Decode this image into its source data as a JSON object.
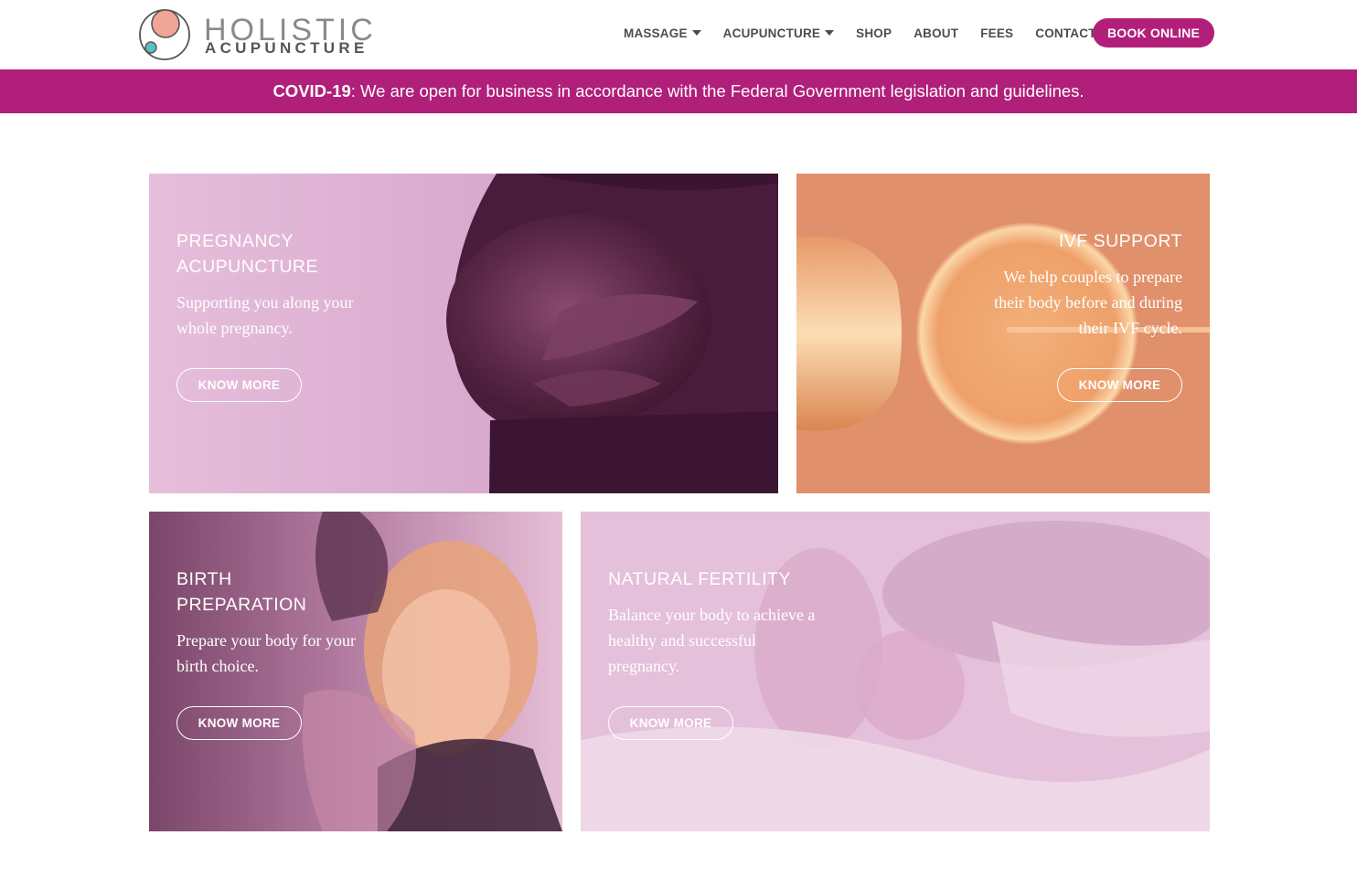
{
  "brand": {
    "line1": "HOLISTIC",
    "line2": "ACUPUNCTURE",
    "colors": {
      "accent": "#b01f79",
      "circle_large": "#f0a597",
      "circle_small": "#5bbfc3"
    }
  },
  "nav": {
    "items": [
      {
        "label": "MASSAGE",
        "dropdown": true
      },
      {
        "label": "ACUPUNCTURE",
        "dropdown": true
      },
      {
        "label": "SHOP",
        "dropdown": false
      },
      {
        "label": "ABOUT",
        "dropdown": false
      },
      {
        "label": "FEES",
        "dropdown": false
      },
      {
        "label": "CONTACT",
        "dropdown": false
      }
    ],
    "book_label": "BOOK ONLINE"
  },
  "banner": {
    "bold": "COVID-19",
    "text": ": We are open for business in accordance with the Federal Government legislation and guidelines."
  },
  "cards": [
    {
      "title": "PREGNANCY ACUPUNCTURE",
      "title_lines": [
        "PREGNANCY",
        "ACUPUNCTURE"
      ],
      "text_lines": [
        "Supporting you along your",
        "whole pregnancy."
      ],
      "button": "KNOW MORE",
      "tint": "#e0b4d6"
    },
    {
      "title": "IVF SUPPORT",
      "title_lines": [
        "IVF SUPPORT"
      ],
      "text_lines": [
        "We help couples to prepare",
        "their body before and during",
        "their IVF cycle."
      ],
      "button": "KNOW MORE",
      "tint": "#e28e66"
    },
    {
      "title": "BIRTH PREPARATION",
      "title_lines": [
        "BIRTH",
        "PREPARATION"
      ],
      "text_lines": [
        "Prepare your body for your",
        "birth choice."
      ],
      "button": "KNOW MORE",
      "tint": "#8a5578"
    },
    {
      "title": "NATURAL FERTILITY",
      "title_lines": [
        "NATURAL FERTILITY"
      ],
      "text_lines": [
        "Balance your body to achieve a",
        "healthy and successful",
        "pregnancy."
      ],
      "button": "KNOW MORE",
      "tint": "#e6c2dc"
    }
  ]
}
